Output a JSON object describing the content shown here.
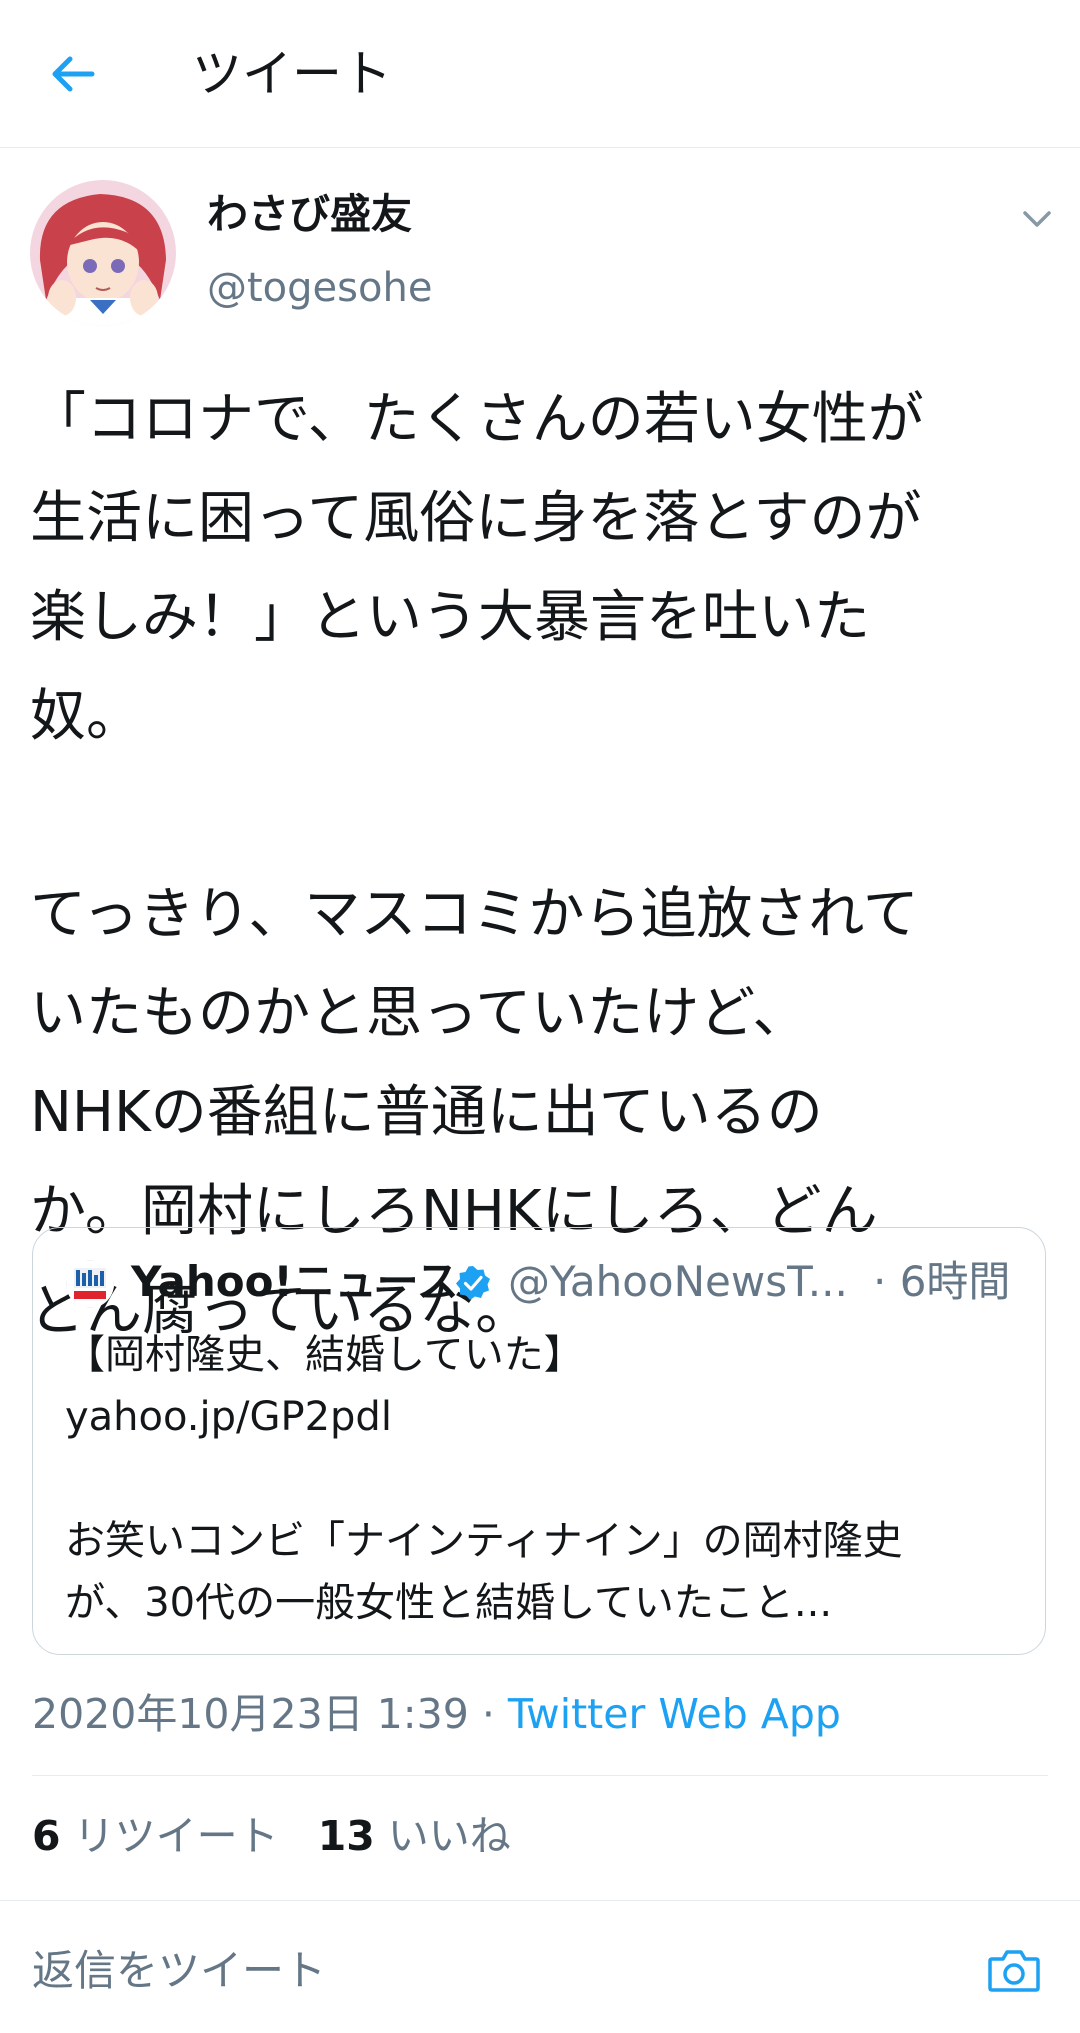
{
  "header": {
    "title": "ツイート",
    "back_icon": "arrow-left-icon"
  },
  "tweet": {
    "display_name": "わさび盛友",
    "handle": "@togesohe",
    "text": "「コロナで、たくさんの若い女性が\n生活に困って風俗に身を落とすのが\n楽しみ！」という大暴言を吐いた\n奴。\n\nてっきり、マスコミから追放されて\nいたものかと思っていたけど、\nNHKの番組に普通に出ているの\nか。岡村にしろNHKにしろ、どん\nどん腐っているな。",
    "timestamp": "2020年10月23日 1:39",
    "separator": " · ",
    "source_app": "Twitter Web App"
  },
  "quote": {
    "name": "Yahoo!ニュース",
    "handle": "@YahooNewsT...",
    "time": "· 6時間",
    "text": "【岡村隆史、結婚していた】\nyahoo.jp/GP2pdl\n\nお笑いコンビ「ナインティナイン」の岡村隆史\nが、30代の一般女性と結婚していたこと..."
  },
  "stats": {
    "retweets_count": "6",
    "retweets_label": "リツイート",
    "likes_count": "13",
    "likes_label": "いいね"
  },
  "reply": {
    "placeholder": "返信をツイート"
  },
  "colors": {
    "accent": "#1da1f2",
    "secondary_text": "#657786",
    "divider": "#e6ecf0"
  }
}
